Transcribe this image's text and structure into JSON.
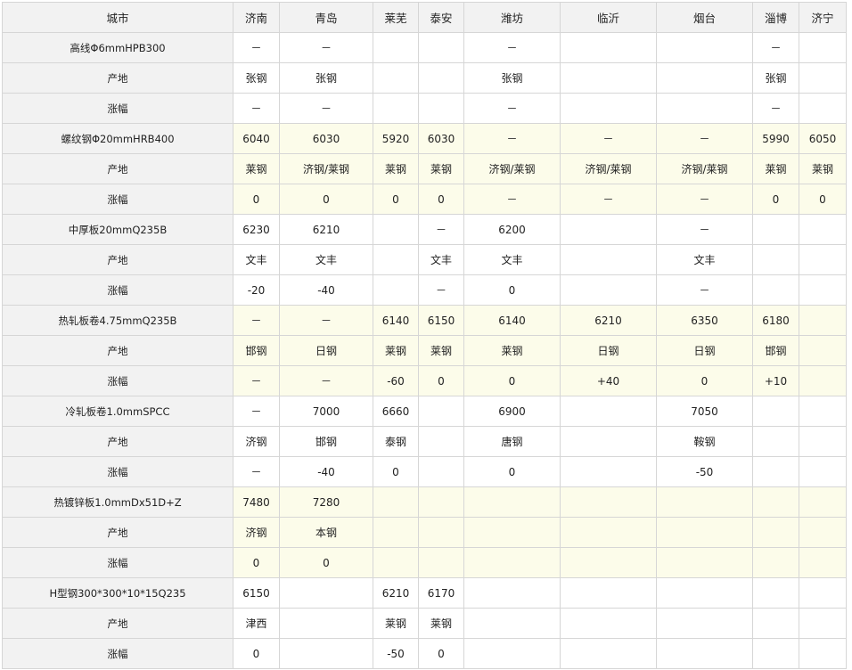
{
  "table": {
    "headers": [
      "城市",
      "济南",
      "青岛",
      "莱芜",
      "泰安",
      "潍坊",
      "临沂",
      "烟台",
      "淄博",
      "济宁"
    ],
    "rows": [
      {
        "label": "高线Φ6mmHPB300",
        "cells": [
          "－",
          "－",
          "",
          "",
          "－",
          "",
          "",
          "－",
          ""
        ],
        "hl": false
      },
      {
        "label": "产地",
        "cells": [
          "张钢",
          "张钢",
          "",
          "",
          "张钢",
          "",
          "",
          "张钢",
          ""
        ],
        "hl": false
      },
      {
        "label": "涨幅",
        "cells": [
          "－",
          "－",
          "",
          "",
          "－",
          "",
          "",
          "－",
          ""
        ],
        "hl": false
      },
      {
        "label": "螺纹钢Φ20mmHRB400",
        "cells": [
          "6040",
          "6030",
          "5920",
          "6030",
          "－",
          "－",
          "－",
          "5990",
          "6050"
        ],
        "hl": true
      },
      {
        "label": "产地",
        "cells": [
          "莱钢",
          "济钢/莱钢",
          "莱钢",
          "莱钢",
          "济钢/莱钢",
          "济钢/莱钢",
          "济钢/莱钢",
          "莱钢",
          "莱钢"
        ],
        "hl": true
      },
      {
        "label": "涨幅",
        "cells": [
          "0",
          "0",
          "0",
          "0",
          "－",
          "－",
          "－",
          "0",
          "0"
        ],
        "hl": true
      },
      {
        "label": "中厚板20mmQ235B",
        "cells": [
          "6230",
          "6210",
          "",
          "－",
          "6200",
          "",
          "－",
          "",
          ""
        ],
        "hl": false
      },
      {
        "label": "产地",
        "cells": [
          "文丰",
          "文丰",
          "",
          "文丰",
          "文丰",
          "",
          "文丰",
          "",
          ""
        ],
        "hl": false
      },
      {
        "label": "涨幅",
        "cells": [
          "-20",
          "-40",
          "",
          "－",
          "0",
          "",
          "－",
          "",
          ""
        ],
        "hl": false
      },
      {
        "label": "热轧板卷4.75mmQ235B",
        "cells": [
          "－",
          "－",
          "6140",
          "6150",
          "6140",
          "6210",
          "6350",
          "6180",
          ""
        ],
        "hl": true
      },
      {
        "label": "产地",
        "cells": [
          "邯钢",
          "日钢",
          "莱钢",
          "莱钢",
          "莱钢",
          "日钢",
          "日钢",
          "邯钢",
          ""
        ],
        "hl": true
      },
      {
        "label": "涨幅",
        "cells": [
          "－",
          "－",
          "-60",
          "0",
          "0",
          "+40",
          "0",
          "+10",
          ""
        ],
        "hl": true
      },
      {
        "label": "冷轧板卷1.0mmSPCC",
        "cells": [
          "－",
          "7000",
          "6660",
          "",
          "6900",
          "",
          "7050",
          "",
          ""
        ],
        "hl": false
      },
      {
        "label": "产地",
        "cells": [
          "济钢",
          "邯钢",
          "泰钢",
          "",
          "唐钢",
          "",
          "鞍钢",
          "",
          ""
        ],
        "hl": false
      },
      {
        "label": "涨幅",
        "cells": [
          "－",
          "-40",
          "0",
          "",
          "0",
          "",
          "-50",
          "",
          ""
        ],
        "hl": false
      },
      {
        "label": "热镀锌板1.0mmDx51D+Z",
        "cells": [
          "7480",
          "7280",
          "",
          "",
          "",
          "",
          "",
          "",
          ""
        ],
        "hl": true
      },
      {
        "label": "产地",
        "cells": [
          "济钢",
          "本钢",
          "",
          "",
          "",
          "",
          "",
          "",
          ""
        ],
        "hl": true
      },
      {
        "label": "涨幅",
        "cells": [
          "0",
          "0",
          "",
          "",
          "",
          "",
          "",
          "",
          ""
        ],
        "hl": true
      },
      {
        "label": "H型钢300*300*10*15Q235",
        "cells": [
          "6150",
          "",
          "6210",
          "6170",
          "",
          "",
          "",
          "",
          ""
        ],
        "hl": false
      },
      {
        "label": "产地",
        "cells": [
          "津西",
          "",
          "莱钢",
          "莱钢",
          "",
          "",
          "",
          "",
          ""
        ],
        "hl": false
      },
      {
        "label": "涨幅",
        "cells": [
          "0",
          "",
          "-50",
          "0",
          "",
          "",
          "",
          "",
          ""
        ],
        "hl": false
      }
    ]
  }
}
